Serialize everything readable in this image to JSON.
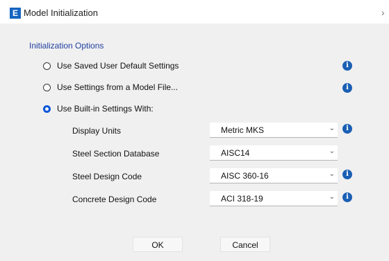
{
  "window": {
    "title": "Model Initialization",
    "app_icon_letter": "E"
  },
  "section_title": "Initialization Options",
  "options": [
    {
      "label": "Use Saved User Default Settings",
      "selected": false
    },
    {
      "label": "Use Settings from a Model File...",
      "selected": false
    },
    {
      "label": "Use Built-in Settings With:",
      "selected": true
    }
  ],
  "settings": [
    {
      "label": "Display Units",
      "value": "Metric MKS",
      "info": true
    },
    {
      "label": "Steel Section Database",
      "value": "AISC14",
      "info": false
    },
    {
      "label": "Steel Design Code",
      "value": "AISC 360-16",
      "info": true
    },
    {
      "label": "Concrete Design Code",
      "value": "ACI 318-19",
      "info": true
    }
  ],
  "buttons": {
    "ok": "OK",
    "cancel": "Cancel"
  },
  "icons": {
    "info": "i",
    "close": "›",
    "chevron": "⌄"
  },
  "colors": {
    "accent": "#0a56d6",
    "section_title": "#1f3f9f",
    "info": "#1a5fb4"
  }
}
